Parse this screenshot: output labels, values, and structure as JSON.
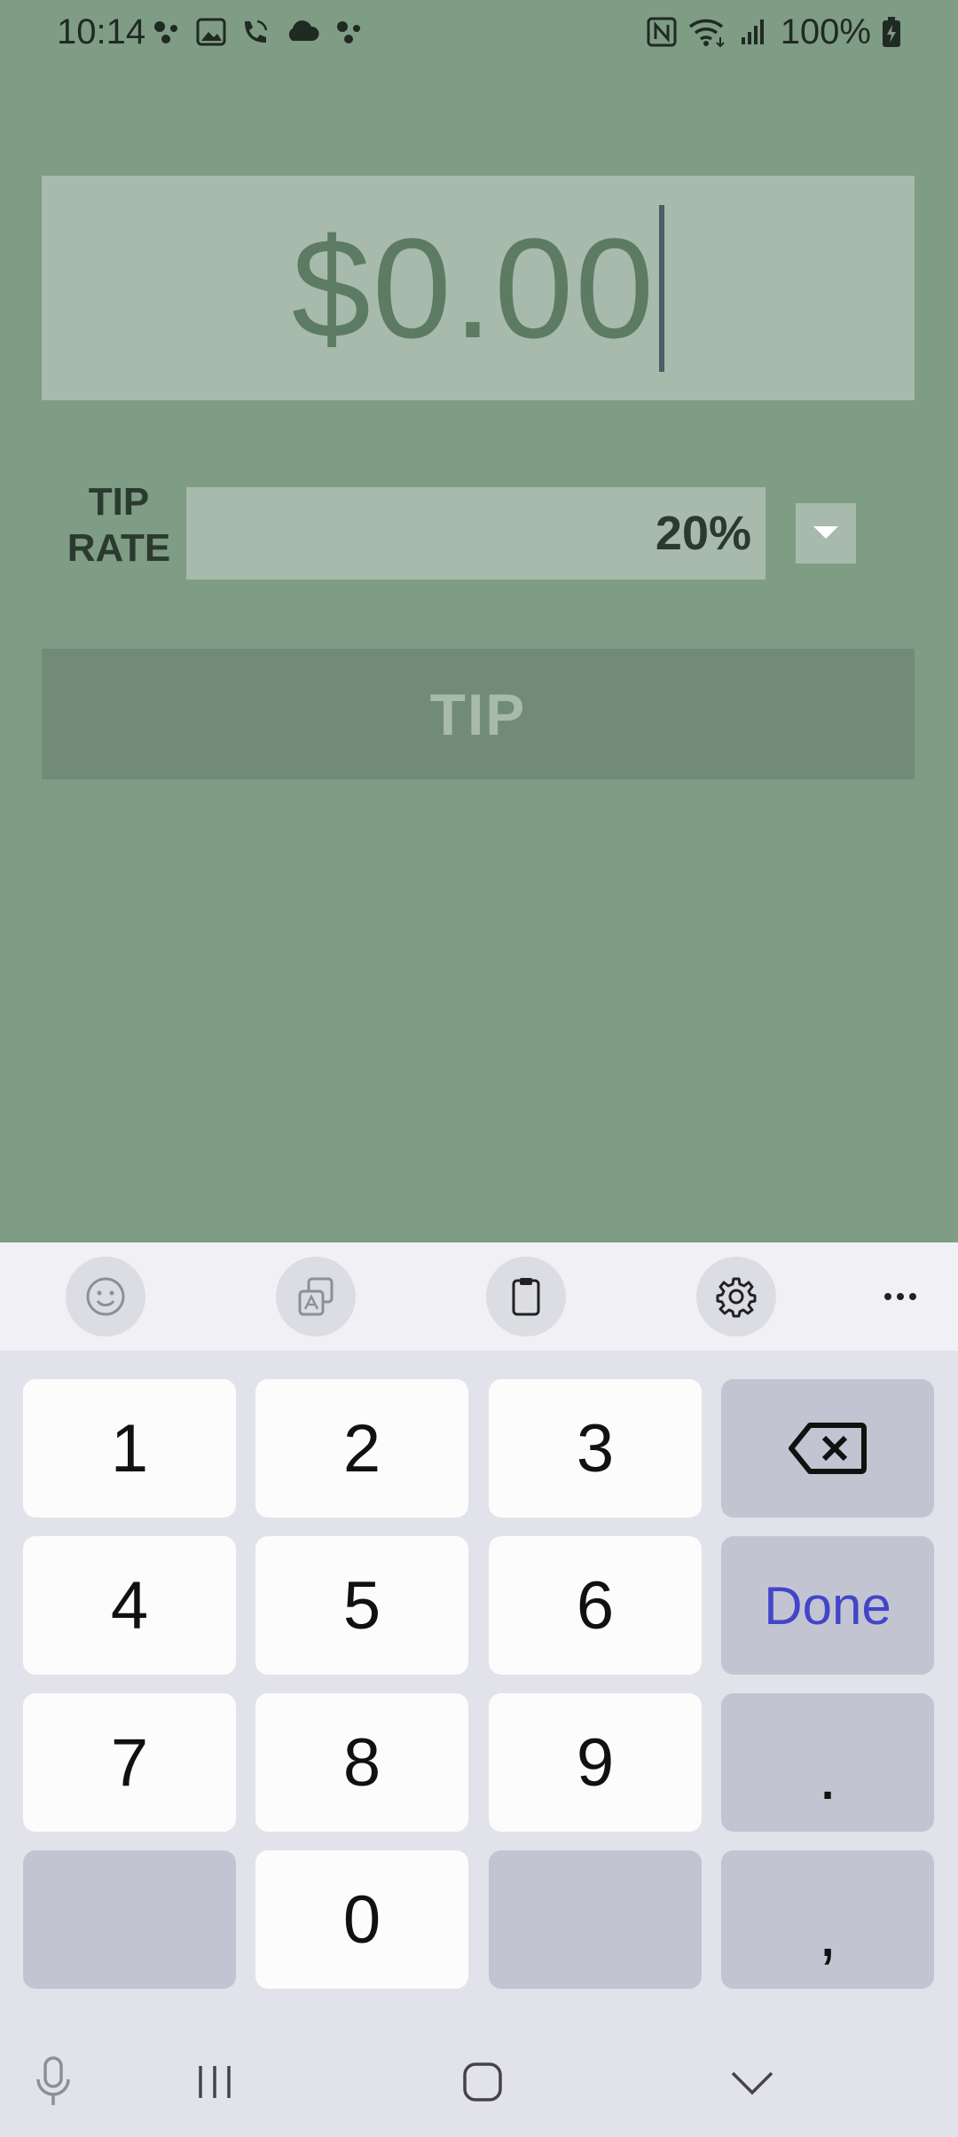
{
  "status_bar": {
    "time": "10:14",
    "battery": "100%",
    "left_icons": [
      "assistant-dots-icon",
      "gallery-icon",
      "wifi-call-icon",
      "cloud-icon",
      "assistant-dots-icon"
    ],
    "right_icons": [
      "nfc-icon",
      "wifi-icon",
      "signal-icon",
      "battery-charging-icon"
    ]
  },
  "amount": {
    "value": "$0.00"
  },
  "tip_rate": {
    "label_line1": "TIP",
    "label_line2": "RATE",
    "value": "20%"
  },
  "tip_button": {
    "label": "TIP"
  },
  "keyboard": {
    "toolbar": [
      "emoji-icon",
      "translate-icon",
      "clipboard-icon",
      "settings-icon",
      "more-icon"
    ],
    "keys": {
      "k1": "1",
      "k2": "2",
      "k3": "3",
      "k4": "4",
      "k5": "5",
      "k6": "6",
      "k7": "7",
      "k8": "8",
      "k9": "9",
      "k0": "0",
      "done": "Done",
      "period": ".",
      "comma": ","
    },
    "done_color": "#4345c9"
  },
  "colors": {
    "background": "#7f9c85",
    "field": "#a7baab",
    "button": "#728b79"
  }
}
